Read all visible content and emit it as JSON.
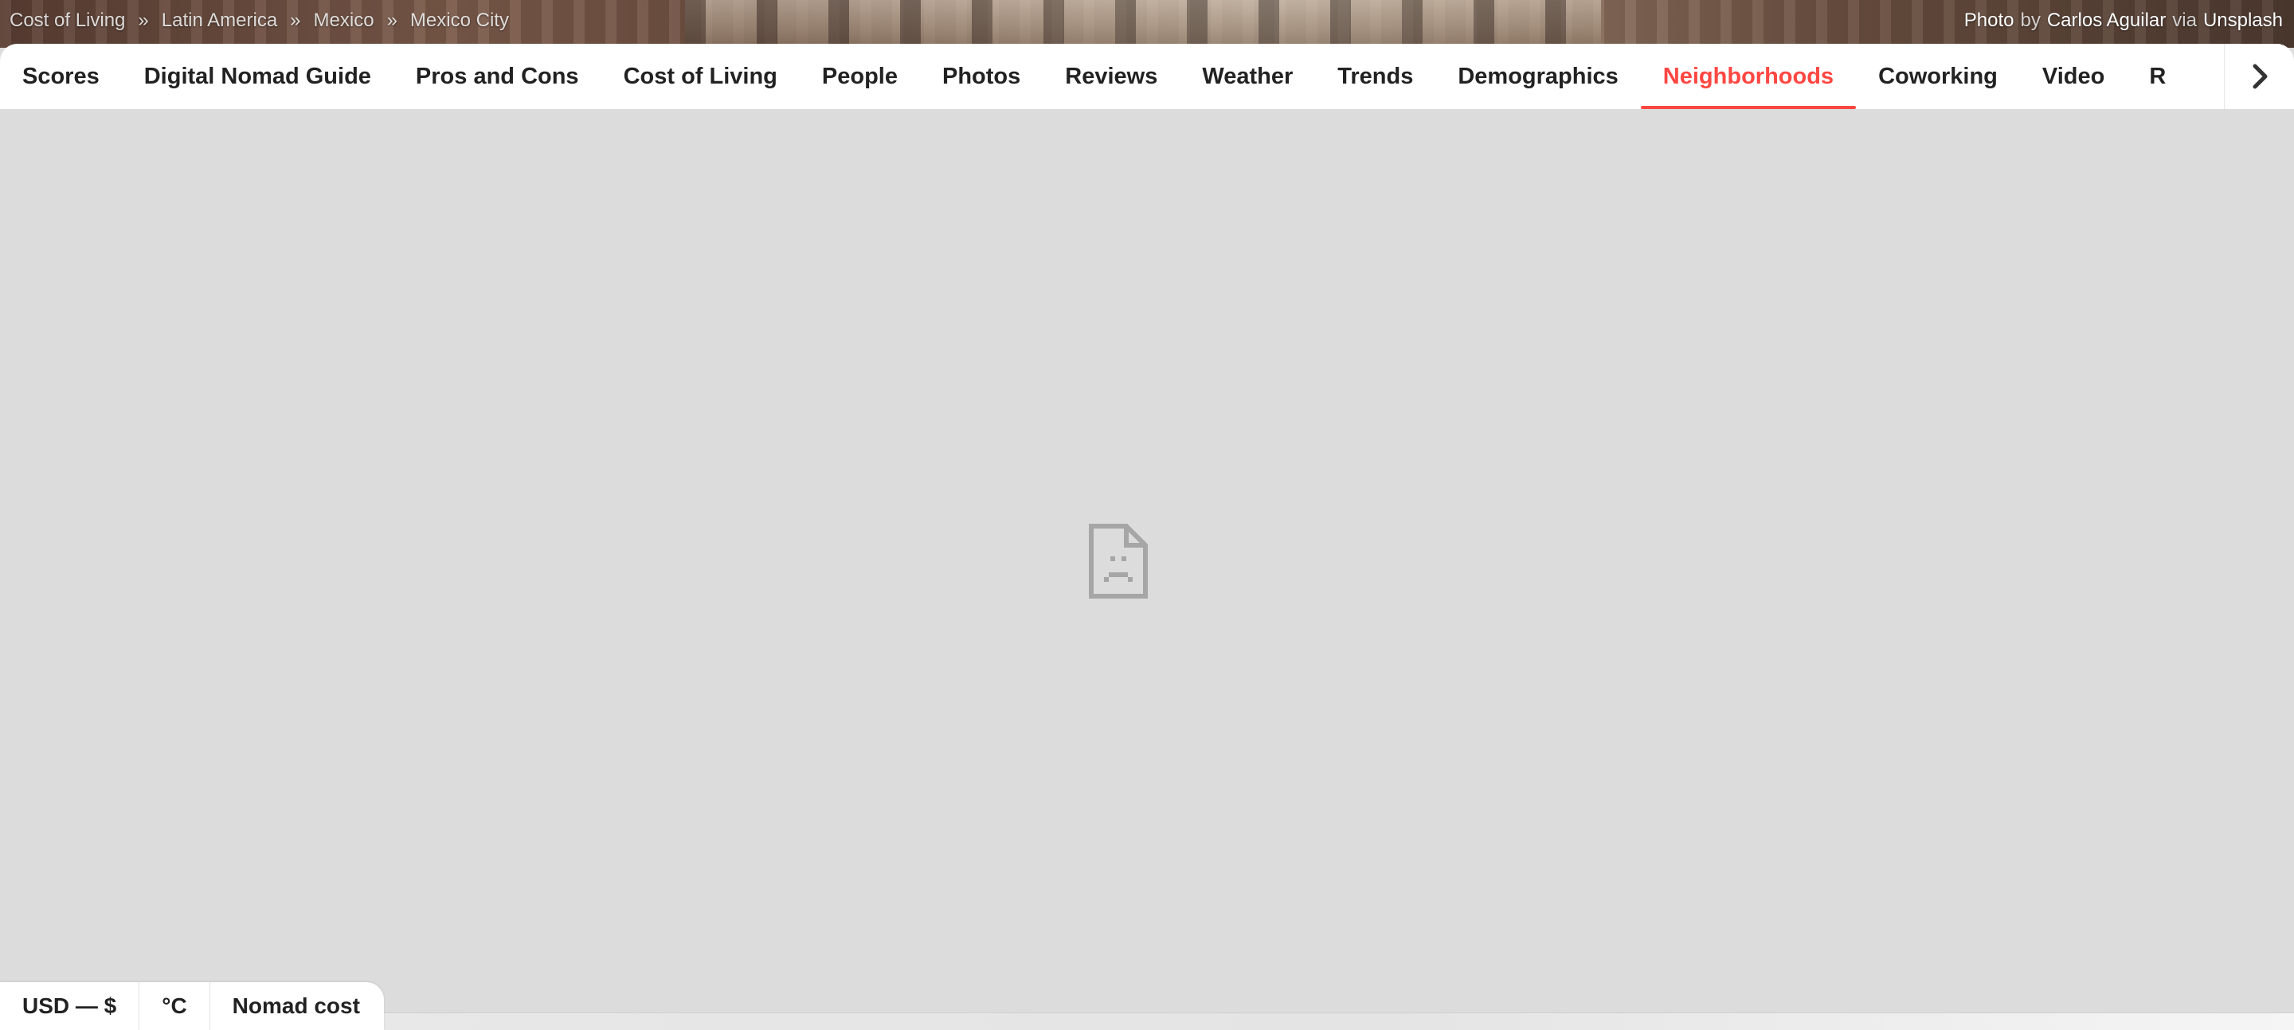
{
  "breadcrumb": {
    "items": [
      "Cost of Living",
      "Latin America",
      "Mexico",
      "Mexico City"
    ],
    "separator": "»"
  },
  "photo_credit": {
    "prefix": "Photo",
    "by": "by",
    "author": "Carlos Aguilar",
    "via": "via",
    "source": "Unsplash"
  },
  "tabs": {
    "items": [
      {
        "label": "Scores"
      },
      {
        "label": "Digital Nomad Guide"
      },
      {
        "label": "Pros and Cons"
      },
      {
        "label": "Cost of Living"
      },
      {
        "label": "People"
      },
      {
        "label": "Photos"
      },
      {
        "label": "Reviews"
      },
      {
        "label": "Weather"
      },
      {
        "label": "Trends"
      },
      {
        "label": "Demographics"
      },
      {
        "label": "Neighborhoods"
      },
      {
        "label": "Coworking"
      },
      {
        "label": "Video"
      },
      {
        "label": "R"
      }
    ],
    "active": "Neighborhoods",
    "active_color": "#ff4742",
    "scroll_icon": "chevron-right-icon"
  },
  "content": {
    "placeholder_icon": "broken-file-icon"
  },
  "bottom_bar": {
    "currency": "USD — $",
    "temperature": "°C",
    "cost_mode": "Nomad cost"
  }
}
